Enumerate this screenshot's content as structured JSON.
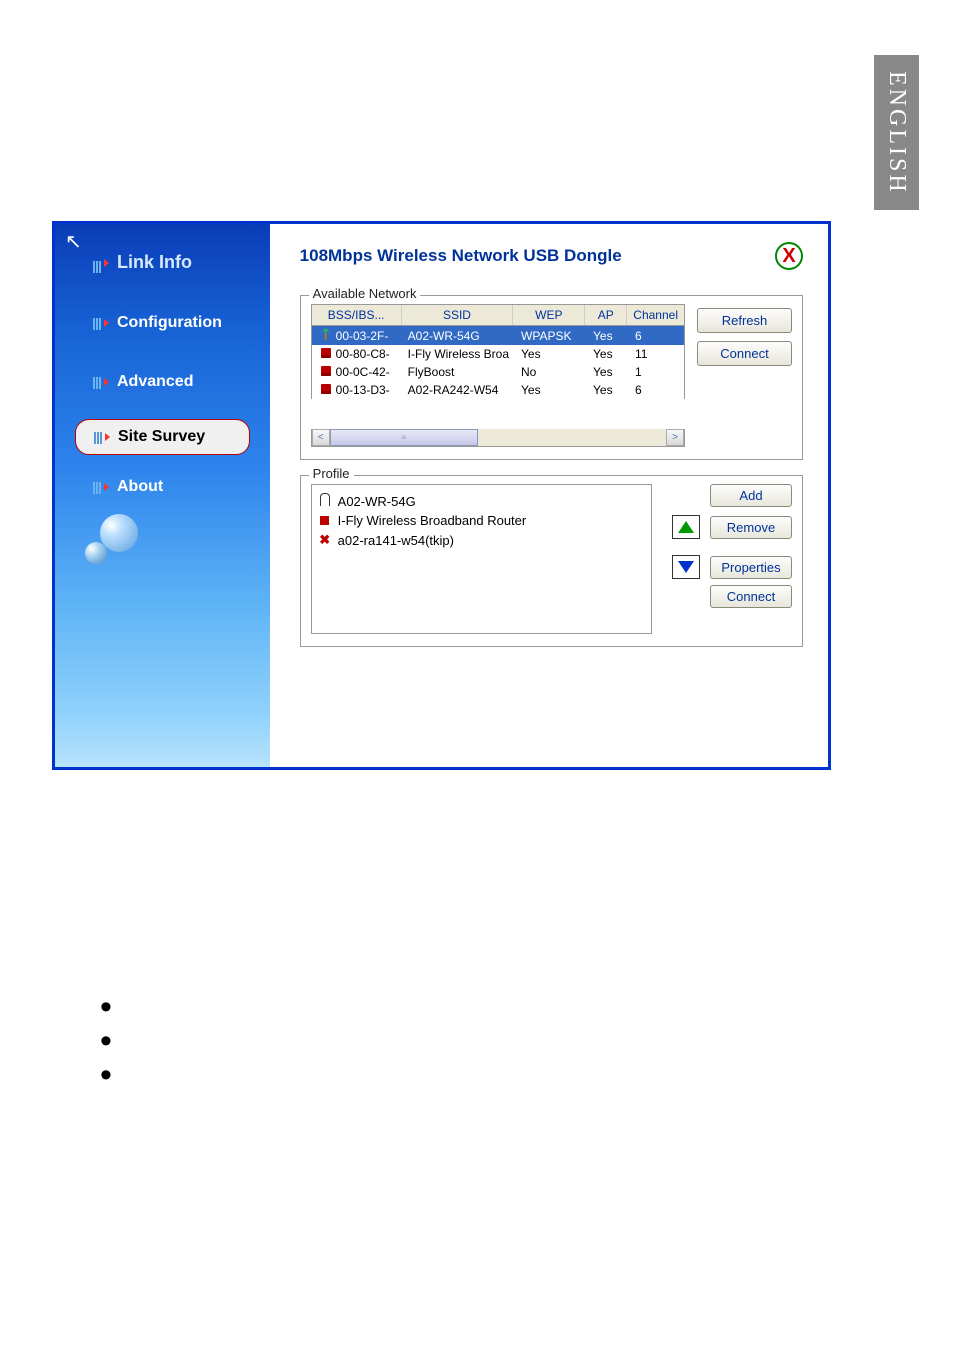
{
  "page_tab": "ENGLISH",
  "app": {
    "title": "108Mbps Wireless Network USB Dongle"
  },
  "sidebar": {
    "items": [
      {
        "label": "Link Info"
      },
      {
        "label": "Configuration"
      },
      {
        "label": "Advanced"
      },
      {
        "label": "Site Survey"
      },
      {
        "label": "About"
      }
    ]
  },
  "available_network": {
    "legend": "Available Network",
    "columns": {
      "bss": "BSS/IBS...",
      "ssid": "SSID",
      "wep": "WEP",
      "ap": "AP",
      "channel": "Channel"
    },
    "rows": [
      {
        "icon": "antenna",
        "bss": "00-03-2F-",
        "ssid": "A02-WR-54G",
        "wep": "WPAPSK",
        "ap": "Yes",
        "channel": "6",
        "selected": true
      },
      {
        "icon": "computer",
        "bss": "00-80-C8-",
        "ssid": "I-Fly Wireless Broa",
        "wep": "Yes",
        "ap": "Yes",
        "channel": "11",
        "selected": false
      },
      {
        "icon": "computer",
        "bss": "00-0C-42-",
        "ssid": "FlyBoost",
        "wep": "No",
        "ap": "Yes",
        "channel": "1",
        "selected": false
      },
      {
        "icon": "computer",
        "bss": "00-13-D3-",
        "ssid": "A02-RA242-W54",
        "wep": "Yes",
        "ap": "Yes",
        "channel": "6",
        "selected": false
      }
    ],
    "buttons": {
      "refresh": "Refresh",
      "connect": "Connect"
    }
  },
  "profile": {
    "legend": "Profile",
    "items": [
      {
        "icon": "ant",
        "label": "A02-WR-54G"
      },
      {
        "icon": "comp",
        "label": "I-Fly Wireless Broadband Router"
      },
      {
        "icon": "x",
        "label": "a02-ra141-w54(tkip)"
      }
    ],
    "buttons": {
      "add": "Add",
      "remove": "Remove",
      "properties": "Properties",
      "connect": "Connect"
    }
  }
}
